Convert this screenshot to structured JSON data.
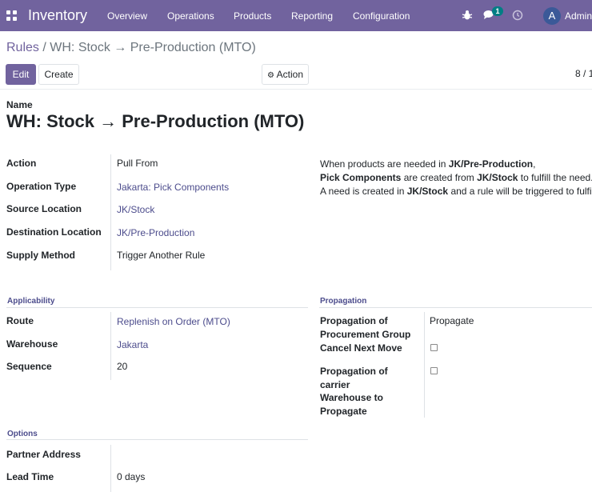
{
  "navbar": {
    "app_name": "Inventory",
    "menu": [
      "Overview",
      "Operations",
      "Products",
      "Reporting",
      "Configuration"
    ],
    "chat_badge": "1",
    "avatar_initial": "A",
    "user_name": "Admin",
    "color": "#71639e"
  },
  "breadcrumb": {
    "parent": "Rules",
    "separator": "/",
    "current": "WH: Stock → Pre-Production (MTO)"
  },
  "toolbar": {
    "edit_label": "Edit",
    "create_label": "Create",
    "action_label": "Action",
    "pager": "8 / 1"
  },
  "form": {
    "name_label": "Name",
    "name_value": "WH: Stock → Pre-Production (MTO)",
    "fields": {
      "action": {
        "label": "Action",
        "value": "Pull From"
      },
      "operation_type": {
        "label": "Operation Type",
        "value": "Jakarta: Pick Components"
      },
      "source_location": {
        "label": "Source Location",
        "value": "JK/Stock"
      },
      "destination_location": {
        "label": "Destination Location",
        "value": "JK/Pre-Production"
      },
      "supply_method": {
        "label": "Supply Method",
        "value": "Trigger Another Rule"
      }
    },
    "help": {
      "line1_a": "When products are needed in ",
      "line1_b": "JK/Pre-Production",
      "line1_c": ",",
      "line2_a": "Pick Components",
      "line2_b": " are created from ",
      "line2_c": "JK/Stock",
      "line2_d": " to fulfill the need.",
      "line3_a": "A need is created in ",
      "line3_b": "JK/Stock",
      "line3_c": " and a rule will be triggered to fulfill it."
    },
    "applicability": {
      "title": "Applicability",
      "route": {
        "label": "Route",
        "value": "Replenish on Order (MTO)"
      },
      "warehouse": {
        "label": "Warehouse",
        "value": "Jakarta"
      },
      "sequence": {
        "label": "Sequence",
        "value": "20"
      }
    },
    "propagation": {
      "title": "Propagation",
      "group_label_1": "Propagation of",
      "group_label_2": "Procurement Group",
      "group_value": "Propagate",
      "cancel_label": "Cancel Next Move",
      "cancel_checked": false,
      "carrier_label_1": "Propagation of",
      "carrier_label_2": "carrier",
      "carrier_checked": false,
      "warehouse_label_1": "Warehouse to",
      "warehouse_label_2": "Propagate"
    },
    "options": {
      "title": "Options",
      "partner": {
        "label": "Partner Address",
        "value": ""
      },
      "lead_time": {
        "label": "Lead Time",
        "value": "0 days"
      }
    }
  }
}
